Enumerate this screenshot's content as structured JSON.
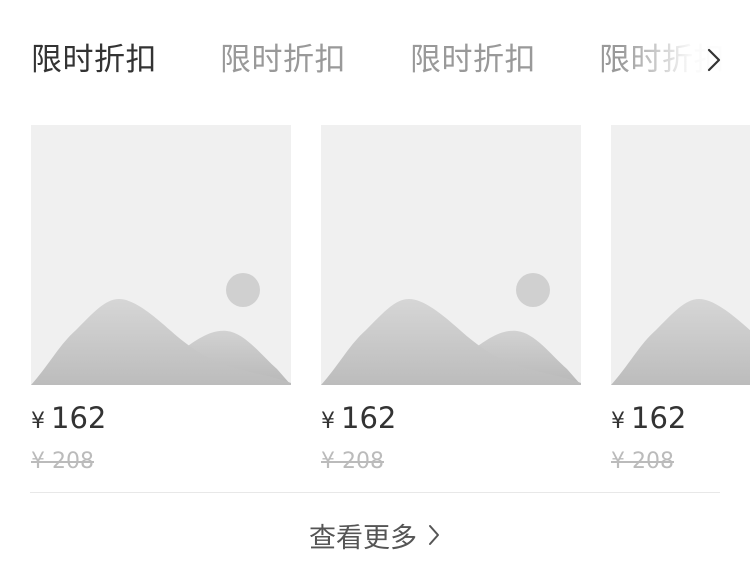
{
  "tabs": [
    {
      "label": "限时折扣",
      "active": true
    },
    {
      "label": "限时折扣",
      "active": false
    },
    {
      "label": "限时折扣",
      "active": false
    },
    {
      "label": "限时折扣",
      "active": false
    }
  ],
  "tabs_arrow_icon": "chevron-right-icon",
  "products": [
    {
      "currency": "¥",
      "price": "162",
      "original_price": "¥ 208",
      "image_icon": "image-placeholder-icon"
    },
    {
      "currency": "¥",
      "price": "162",
      "original_price": "¥ 208",
      "image_icon": "image-placeholder-icon"
    },
    {
      "currency": "¥",
      "price": "162",
      "original_price": "¥ 208",
      "image_icon": "image-placeholder-icon"
    }
  ],
  "view_more": {
    "label": "查看更多",
    "icon": "chevron-right-icon"
  },
  "colors": {
    "text_primary": "#333333",
    "text_inactive": "#999999",
    "text_strike": "#bbbbbb",
    "placeholder_bg": "#f0f0f0",
    "divider": "#e8e8e8"
  }
}
